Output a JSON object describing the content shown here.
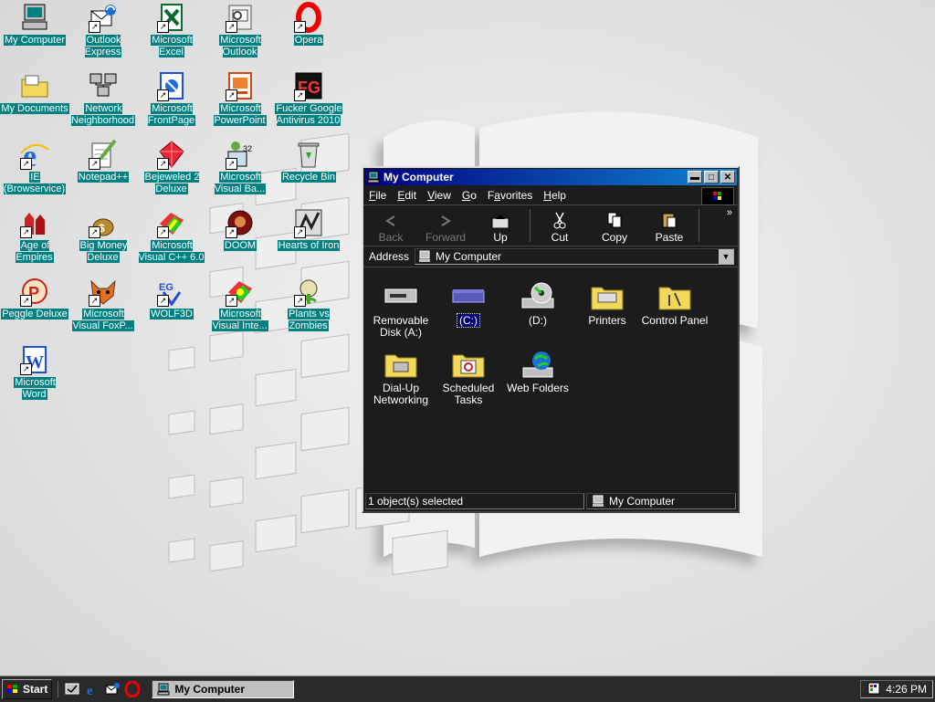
{
  "desktop": {
    "icons": [
      {
        "label": "My Computer",
        "icon": "my-computer-icon"
      },
      {
        "label": "Outlook\nExpress",
        "icon": "outlook-express-icon"
      },
      {
        "label": "Microsoft\nExcel",
        "icon": "excel-icon"
      },
      {
        "label": "Microsoft\nOutlook",
        "icon": "outlook-icon"
      },
      {
        "label": "Opera",
        "icon": "opera-icon"
      },
      {
        "label": "My Documents",
        "icon": "folder-icon"
      },
      {
        "label": "Network\nNeighborhood",
        "icon": "network-icon"
      },
      {
        "label": "Microsoft\nFrontPage",
        "icon": "frontpage-icon"
      },
      {
        "label": "Microsoft\nPowerPoint",
        "icon": "powerpoint-icon"
      },
      {
        "label": "Fucker Google\nAntivirus 2010",
        "icon": "fg-antivirus-icon"
      },
      {
        "label": "IE\n(Browservice)",
        "icon": "ie-icon"
      },
      {
        "label": "Notepad++",
        "icon": "notepad-icon"
      },
      {
        "label": "Bejeweled 2\nDeluxe",
        "icon": "bejeweled-icon"
      },
      {
        "label": "Microsoft\nVisual Ba...",
        "icon": "visual-basic-icon"
      },
      {
        "label": "Recycle Bin",
        "icon": "recycle-bin-icon"
      },
      {
        "label": "Age of Empires",
        "icon": "age-of-empires-icon"
      },
      {
        "label": "Big Money\nDeluxe",
        "icon": "big-money-icon"
      },
      {
        "label": "Microsoft\nVisual C++ 6.0",
        "icon": "visual-cpp-icon"
      },
      {
        "label": "DOOM",
        "icon": "doom-icon"
      },
      {
        "label": "Hearts of Iron",
        "icon": "hearts-of-iron-icon"
      },
      {
        "label": "Peggle Deluxe",
        "icon": "peggle-icon"
      },
      {
        "label": "Microsoft\nVisual FoxP...",
        "icon": "foxpro-icon"
      },
      {
        "label": "WOLF3D",
        "icon": "wolf3d-icon"
      },
      {
        "label": "Microsoft\nVisual Inte...",
        "icon": "visual-interdev-icon"
      },
      {
        "label": "Plants vs\nZombies",
        "icon": "plants-vs-zombies-icon"
      },
      {
        "label": "Microsoft\nWord",
        "icon": "word-icon"
      }
    ]
  },
  "window": {
    "title": "My Computer",
    "menu": [
      "File",
      "Edit",
      "View",
      "Go",
      "Favorites",
      "Help"
    ],
    "menu_keys": [
      "F",
      "E",
      "V",
      "G",
      "a",
      "H"
    ],
    "toolbar": {
      "back": "Back",
      "forward": "Forward",
      "up": "Up",
      "cut": "Cut",
      "copy": "Copy",
      "paste": "Paste"
    },
    "address_label": "Address",
    "address_value": "My Computer",
    "items": [
      {
        "label": "Removable\nDisk (A:)",
        "icon": "floppy-drive-icon"
      },
      {
        "label": "(C:)",
        "icon": "hard-drive-icon",
        "selected": true
      },
      {
        "label": "(D:)",
        "icon": "cd-drive-icon"
      },
      {
        "label": "Printers",
        "icon": "printers-folder-icon"
      },
      {
        "label": "Control Panel",
        "icon": "control-panel-icon"
      },
      {
        "label": "Dial-Up\nNetworking",
        "icon": "dialup-folder-icon"
      },
      {
        "label": "Scheduled\nTasks",
        "icon": "scheduled-tasks-icon"
      },
      {
        "label": "Web Folders",
        "icon": "web-folders-icon"
      }
    ],
    "status_left": "1 object(s) selected",
    "status_right": "My Computer"
  },
  "taskbar": {
    "start_label": "Start",
    "task_label": "My Computer",
    "clock": "4:26 PM"
  },
  "colors": {
    "desktop_label_bg": "#008080",
    "title_active": "#000080",
    "window_bg": "#1c1c1c",
    "selection": "#00006e"
  }
}
